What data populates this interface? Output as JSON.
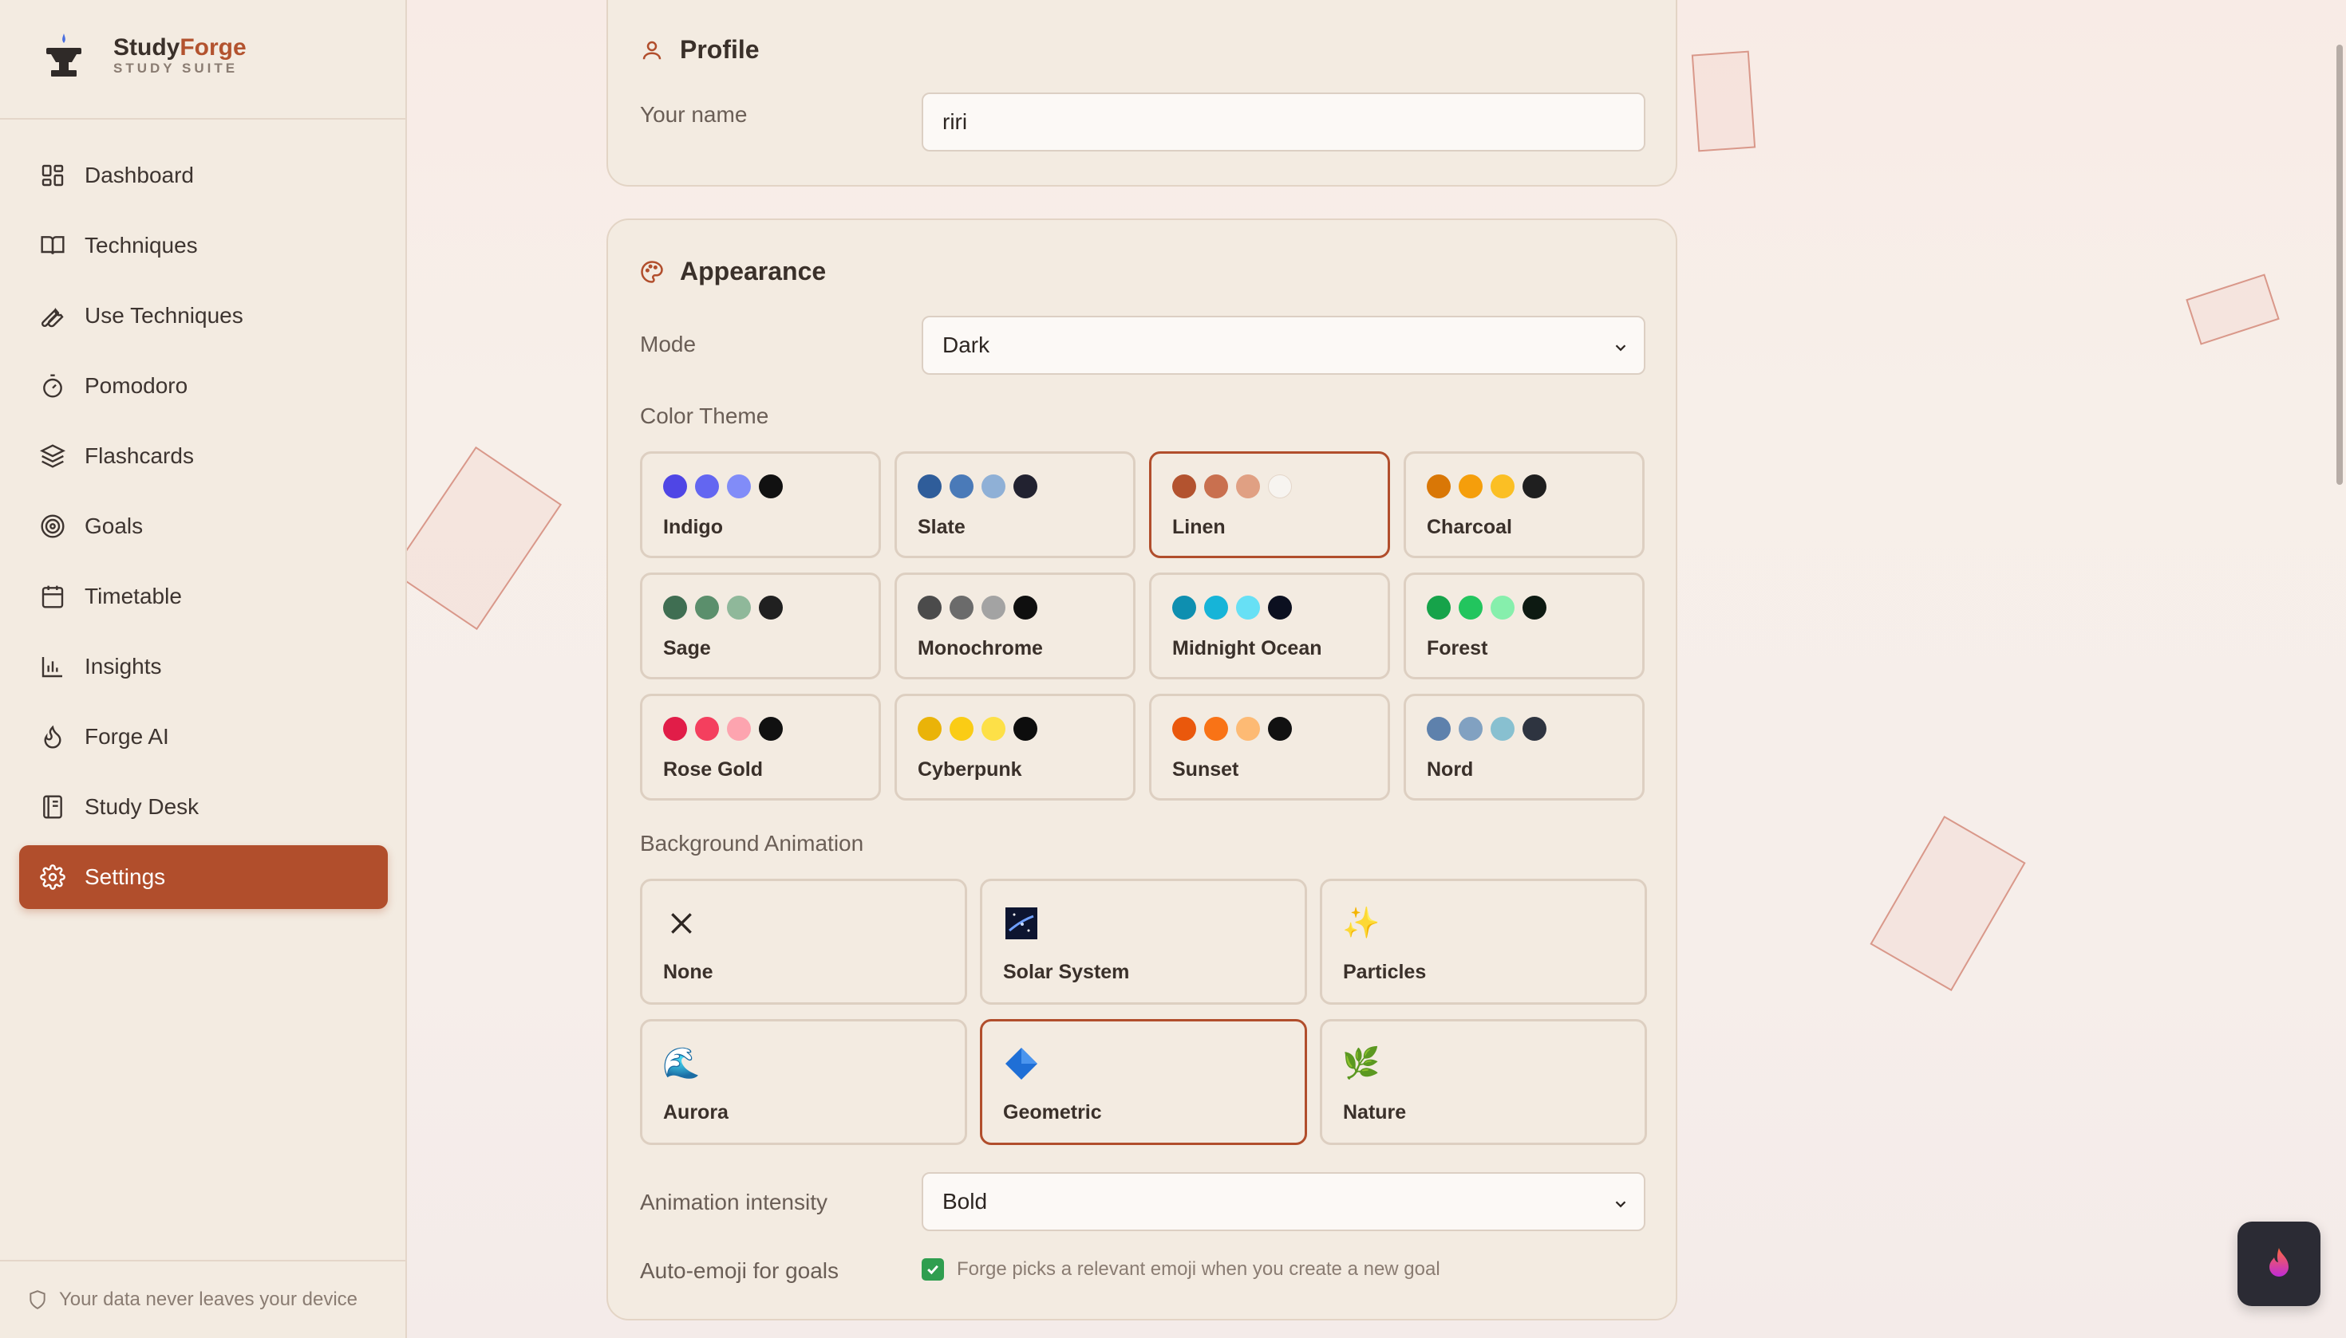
{
  "brand": {
    "name_part1": "Study",
    "name_part2": "Forge",
    "subtitle": "STUDY SUITE"
  },
  "nav": {
    "items": [
      {
        "label": "Dashboard",
        "icon": "grid-icon"
      },
      {
        "label": "Techniques",
        "icon": "book-icon"
      },
      {
        "label": "Use Techniques",
        "icon": "wrench-icon"
      },
      {
        "label": "Pomodoro",
        "icon": "timer-icon"
      },
      {
        "label": "Flashcards",
        "icon": "layers-icon"
      },
      {
        "label": "Goals",
        "icon": "target-icon"
      },
      {
        "label": "Timetable",
        "icon": "calendar-icon"
      },
      {
        "label": "Insights",
        "icon": "bar-chart-icon"
      },
      {
        "label": "Forge AI",
        "icon": "flame-icon"
      },
      {
        "label": "Study Desk",
        "icon": "notebook-icon"
      },
      {
        "label": "Settings",
        "icon": "gear-icon",
        "active": true
      }
    ]
  },
  "footer": {
    "privacy_note": "Your data never leaves your device"
  },
  "profile": {
    "title": "Profile",
    "name_label": "Your name",
    "name_value": "riri"
  },
  "appearance": {
    "title": "Appearance",
    "mode_label": "Mode",
    "mode_value": "Dark",
    "color_theme_label": "Color Theme",
    "themes": [
      {
        "name": "Indigo",
        "colors": [
          "#4f46e5",
          "#6366f1",
          "#818cf8",
          "#111111"
        ]
      },
      {
        "name": "Slate",
        "colors": [
          "#2f5d9a",
          "#4a7ab8",
          "#8fb0d6",
          "#222230"
        ]
      },
      {
        "name": "Linen",
        "colors": [
          "#b3532f",
          "#c9704f",
          "#e0a083",
          "#f7f4f0"
        ],
        "selected": true
      },
      {
        "name": "Charcoal",
        "colors": [
          "#d97706",
          "#f59e0b",
          "#fbbf24",
          "#1f1f1f"
        ]
      },
      {
        "name": "Sage",
        "colors": [
          "#3f6e52",
          "#5b8f6c",
          "#8fb89a",
          "#202020"
        ]
      },
      {
        "name": "Monochrome",
        "colors": [
          "#4b4b4b",
          "#6b6b6b",
          "#a3a3a3",
          "#0f0f0f"
        ]
      },
      {
        "name": "Midnight Ocean",
        "colors": [
          "#0e8fb0",
          "#16b4d8",
          "#67e0f5",
          "#0c1020"
        ]
      },
      {
        "name": "Forest",
        "colors": [
          "#16a34a",
          "#22c55e",
          "#86efac",
          "#0d1a12"
        ]
      },
      {
        "name": "Rose Gold",
        "colors": [
          "#e11d48",
          "#f43f5e",
          "#fda4af",
          "#111111"
        ]
      },
      {
        "name": "Cyberpunk",
        "colors": [
          "#eab308",
          "#facc15",
          "#fde047",
          "#0d0d0d"
        ]
      },
      {
        "name": "Sunset",
        "colors": [
          "#ea580c",
          "#f97316",
          "#fdba74",
          "#111111"
        ]
      },
      {
        "name": "Nord",
        "colors": [
          "#5e81ac",
          "#81a1c1",
          "#88c0d0",
          "#2e3440"
        ]
      }
    ],
    "background_animation_label": "Background Animation",
    "animations": [
      {
        "name": "None",
        "icon": "x-icon"
      },
      {
        "name": "Solar System",
        "icon": "galaxy-icon"
      },
      {
        "name": "Particles",
        "icon": "sparkles-icon",
        "glyph": "✨"
      },
      {
        "name": "Aurora",
        "icon": "wave-icon",
        "glyph": "🌊"
      },
      {
        "name": "Geometric",
        "icon": "diamond-icon",
        "selected": true
      },
      {
        "name": "Nature",
        "icon": "herb-icon",
        "glyph": "🌿"
      }
    ],
    "intensity_label": "Animation intensity",
    "intensity_value": "Bold",
    "auto_emoji_label": "Auto-emoji for goals",
    "auto_emoji_desc": "Forge picks a relevant emoji when you create a new goal",
    "auto_emoji_checked": true
  },
  "colors": {
    "accent": "#b14e2c",
    "sidebar_bg": "#f3ebe1",
    "card_bg": "#f3ebe1"
  }
}
